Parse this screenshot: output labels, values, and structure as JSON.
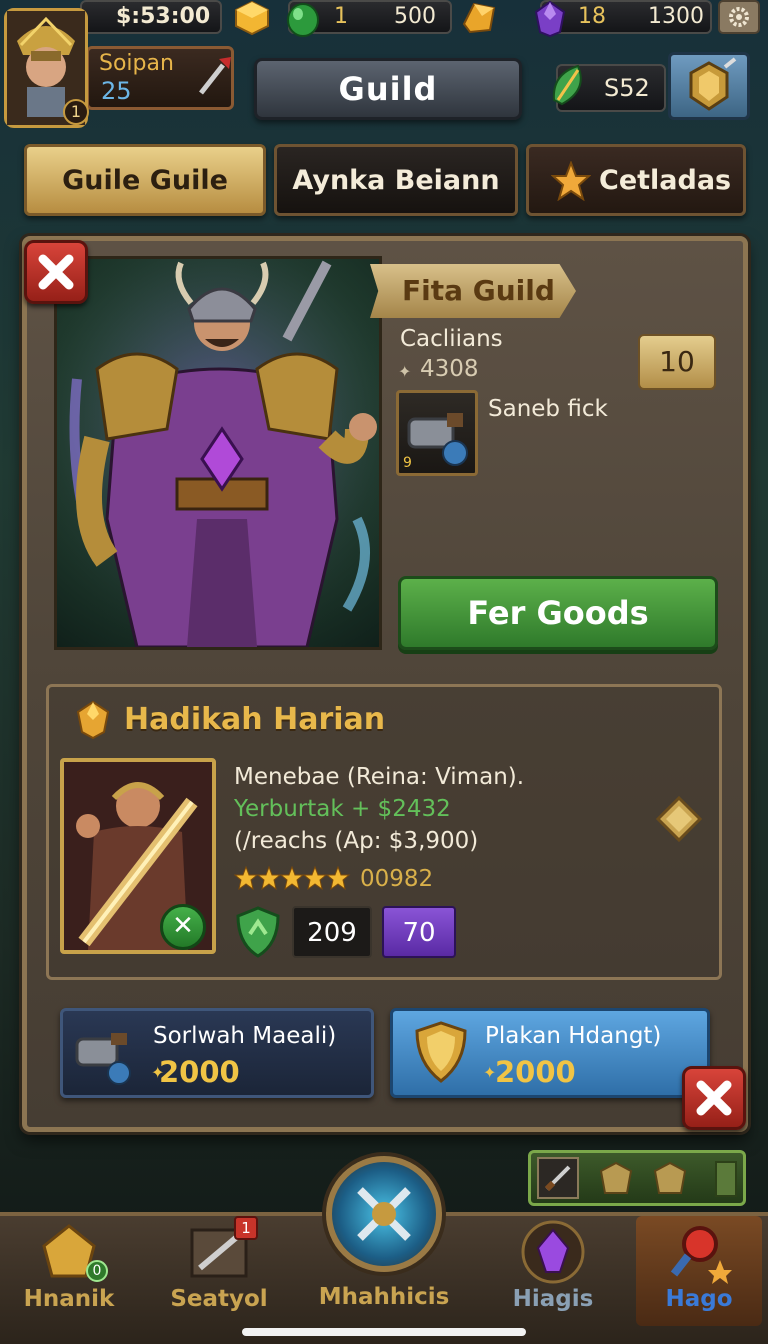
{
  "resources": {
    "timer": "$:53:00",
    "emerald_count": "1",
    "gold_count": "500",
    "gem_count": "18",
    "gem_total": "1300"
  },
  "profile": {
    "name": "Soipan",
    "level": "25",
    "rank": "1"
  },
  "header": {
    "title": "Guild",
    "currency_value": "S52"
  },
  "tabs": [
    {
      "label": "Guile Guile"
    },
    {
      "label": "Aynka Beiann"
    },
    {
      "label": "Cetladas"
    }
  ],
  "guild_card": {
    "banner": "Fita Guild",
    "category": "Cacliians",
    "value": "4308",
    "count": "10",
    "item_name": "Saneb fick",
    "item_level": "9",
    "action_label": "Fer Goods"
  },
  "daily": {
    "title": "Hadikah Harian",
    "line1": "Menebae (Reina: Viman).",
    "line2": "Yerburtak + $2432",
    "line3": "(/reachs (Ap: $3,900)",
    "rating_value": "00982",
    "stat1": "209",
    "stat2": "70"
  },
  "offers": [
    {
      "label": "Sorlwah Maeali)",
      "price": "2000"
    },
    {
      "label": "Plakan Hdangt)",
      "price": "2000"
    }
  ],
  "nav": [
    {
      "label": "Hnanik",
      "badge": "0"
    },
    {
      "label": "Seatyol",
      "badge": "1"
    },
    {
      "label": "Mhahhicis"
    },
    {
      "label": "Hiagis"
    },
    {
      "label": "Hago"
    }
  ],
  "colors": {
    "accent_gold": "#e8b84b",
    "action_green": "#3f8f35",
    "offer_blue": "#3d86c4",
    "close_red": "#c8342a"
  }
}
